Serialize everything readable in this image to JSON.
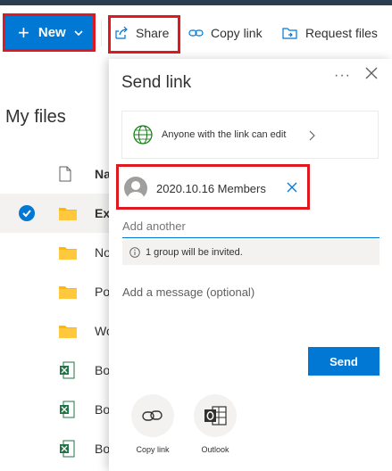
{
  "commandbar": {
    "new_label": "New",
    "share_label": "Share",
    "copy_link_label": "Copy link",
    "request_files_label": "Request files"
  },
  "files": {
    "title": "My files",
    "rows": [
      {
        "name": "Na",
        "icon": "file-icon",
        "header": true
      },
      {
        "name": "Ex",
        "icon": "folder-icon",
        "selected": true
      },
      {
        "name": "No",
        "icon": "folder-icon"
      },
      {
        "name": "Po",
        "icon": "folder-icon"
      },
      {
        "name": "Wo",
        "icon": "folder-icon"
      },
      {
        "name": "Bo",
        "icon": "excel-icon"
      },
      {
        "name": "Bo",
        "icon": "excel-icon"
      },
      {
        "name": "Bo",
        "icon": "excel-icon"
      }
    ]
  },
  "panel": {
    "title": "Send link",
    "permission": "Anyone with the link can edit",
    "recipient": "2020.10.16 Members",
    "add_another_placeholder": "Add another",
    "info": "1 group will be invited.",
    "message_placeholder": "Add a message (optional)",
    "send_label": "Send",
    "share_options": [
      {
        "label": "Copy link",
        "icon": "link-icon"
      },
      {
        "label": "Outlook",
        "icon": "outlook-icon"
      }
    ]
  },
  "colors": {
    "accent": "#0078d4",
    "highlight_box": "#e0191e",
    "folder": "#ffb900",
    "excel": "#217346"
  }
}
